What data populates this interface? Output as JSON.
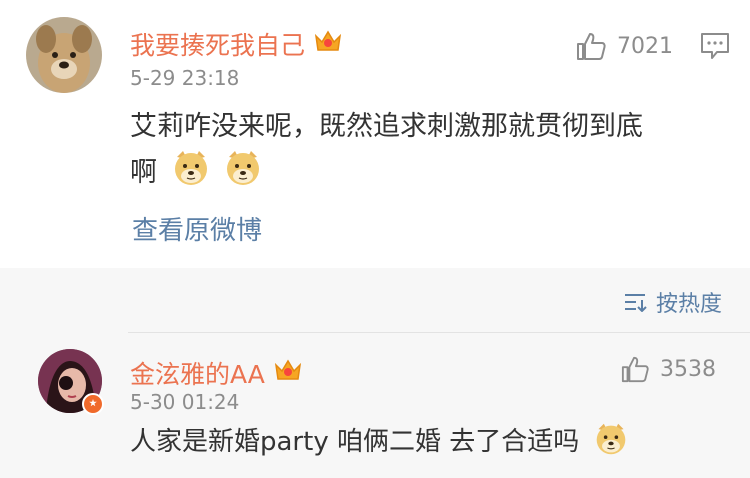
{
  "comment_main": {
    "username": "我要揍死我自己",
    "timestamp": "5-29 23:18",
    "likes": "7021",
    "text_line1": "艾莉咋没来呢，既然追求刺激那就贯彻到底",
    "text_line2": "啊",
    "view_original": "查看原微博"
  },
  "sort": {
    "label": "按热度"
  },
  "reply": {
    "username": "金泫雅的AA",
    "timestamp": "5-30 01:24",
    "likes": "3538",
    "text": "人家是新婚party 咱俩二婚 去了合适吗"
  },
  "colors": {
    "username": "#eb7350",
    "link": "#5b7fa6",
    "meta": "#8c8c8c",
    "text": "#333333"
  },
  "icons": [
    "thumbs-up-icon",
    "message-icon",
    "sort-icon",
    "crown-icon",
    "doge-emoji",
    "vip-badge"
  ]
}
